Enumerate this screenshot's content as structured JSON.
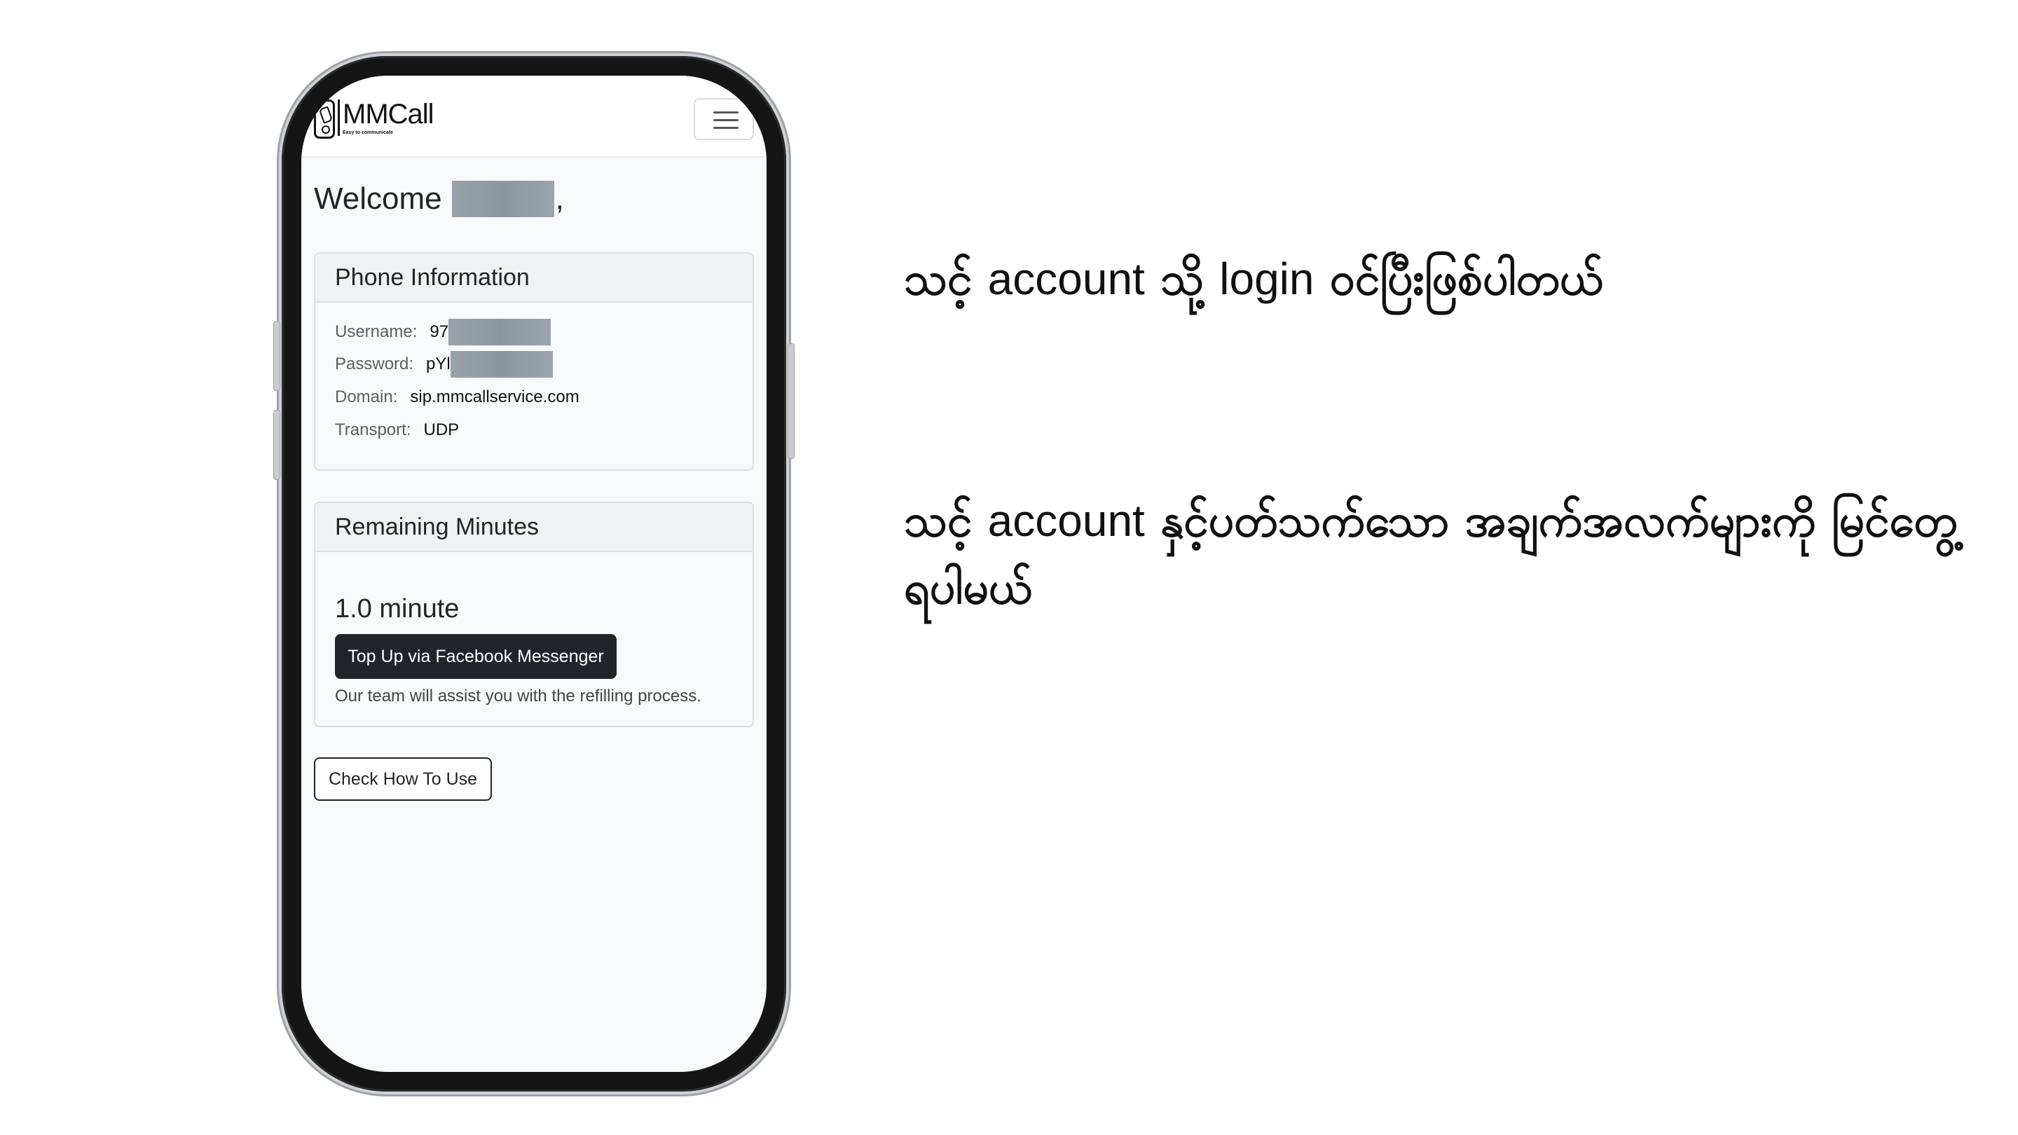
{
  "app": {
    "brand_name": "MMCall",
    "brand_tagline": "Easy to communicate"
  },
  "welcome": {
    "text": "Welcome",
    "comma": ","
  },
  "phone_info": {
    "title": "Phone Information",
    "rows": [
      {
        "label": "Username:",
        "value": "97"
      },
      {
        "label": "Password:",
        "value": "pYl"
      },
      {
        "label": "Domain:",
        "value": "sip.mmcallservice.com"
      },
      {
        "label": "Transport:",
        "value": "UDP"
      }
    ]
  },
  "minutes": {
    "title": "Remaining Minutes",
    "value": "1.0 minute",
    "topup_label": "Top Up via Facebook Messenger",
    "assist_text": "Our team will assist you with the refilling process."
  },
  "howto_label": "Check How To Use",
  "captions": {
    "line1": {
      "part1": "သင့်",
      "part2": "account",
      "part3": "သို့",
      "part4": "login",
      "part5": "ဝင်ပြီးဖြစ်ပါတယ်"
    },
    "line2": {
      "part1": "သင့်",
      "part2": "account",
      "part3": "နှင့်ပတ်သက်သော အချက်အလက်များကို မြင်တွေ့ရပါမယ်"
    }
  },
  "icons": {
    "menu": "hamburger-menu-icon",
    "brand": "phone-logo-icon"
  }
}
